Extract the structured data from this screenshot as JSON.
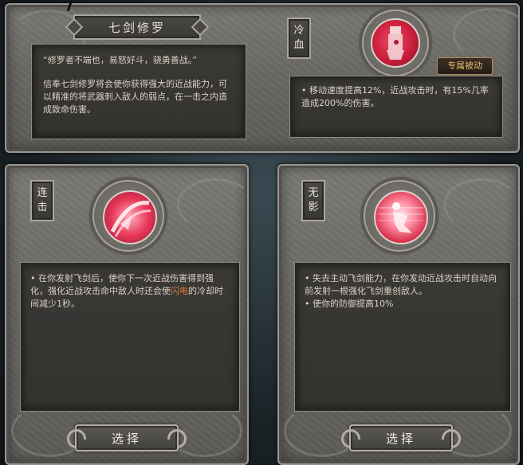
{
  "top_panel": {
    "title": "七剑修罗",
    "quote": "“修罗者不端也，易怒好斗，骁勇善战。”",
    "description": "信奉七剑修罗将会使你获得强大的近战能力，可以精准的将武器刺入敌人的弱点，在一击之内造成致命伤害。",
    "skill_name": "冷血",
    "tag": "专属被动",
    "skill_desc": "• 移动速度提高12%，近战攻击时，有15%几率造成200%的伤害。"
  },
  "left_card": {
    "skill_name": "连击",
    "desc_part1": "• 在你发射飞剑后，使你下一次近战伤害得到强化，强化近战攻击命中敌人时还会使",
    "desc_highlight": "闪电",
    "desc_part2": "的冷却时间减少1秒。",
    "select_label": "选择"
  },
  "right_card": {
    "skill_name": "无影",
    "desc_line1": "• 失去主动飞剑能力，在你发动近战攻击时自动向前发射一根强化飞剑重创敌人。",
    "desc_line2": "• 使你的防御提高10%",
    "select_label": "选择"
  },
  "colors": {
    "accent_red": "#d02a45",
    "highlight_orange": "#e07a3a",
    "tag_gold": "#e8b86c"
  },
  "icons": [
    "bleeding-fist-icon",
    "slash-strike-icon",
    "kneeling-figure-icon"
  ]
}
